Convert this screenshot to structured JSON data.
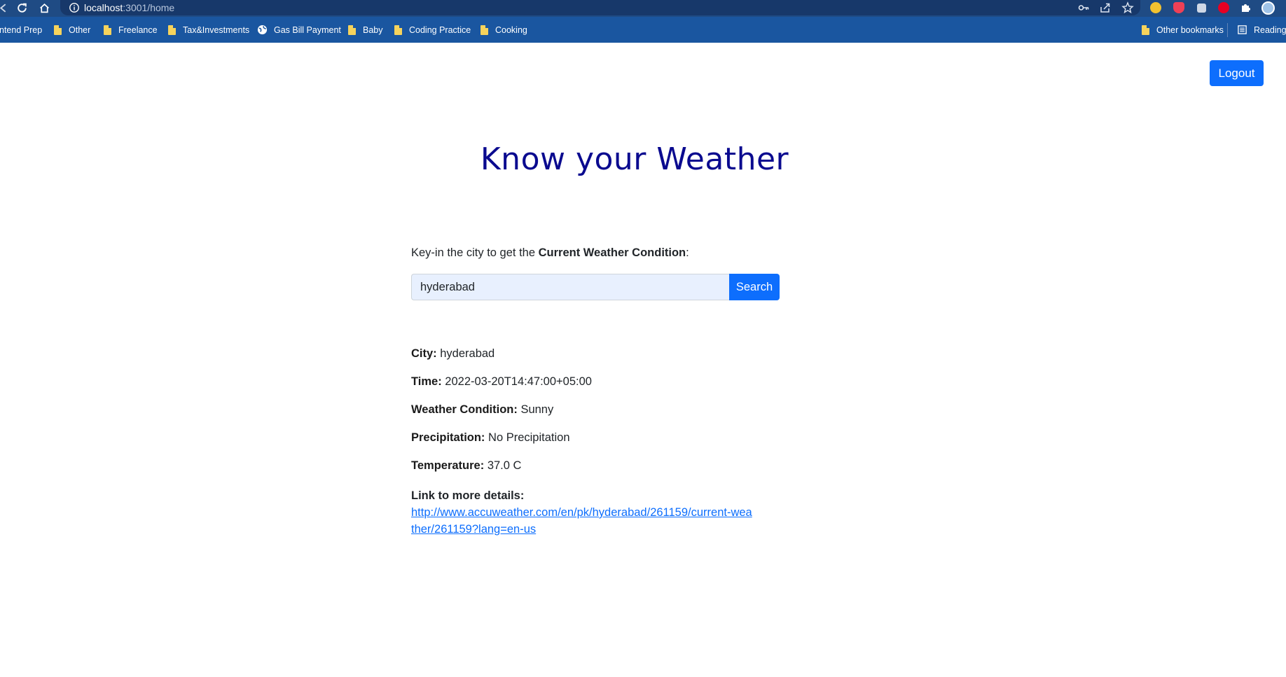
{
  "browser": {
    "address": {
      "host": "localhost",
      "path": ":3001/home"
    },
    "bookmarks": [
      {
        "label": "ntend Prep",
        "icon": "none"
      },
      {
        "label": "Other",
        "icon": "folder-icon"
      },
      {
        "label": "Freelance",
        "icon": "folder-icon"
      },
      {
        "label": "Tax&Investments",
        "icon": "folder-icon"
      },
      {
        "label": "Gas Bill Payment",
        "icon": "globe-icon"
      },
      {
        "label": "Baby",
        "icon": "folder-icon"
      },
      {
        "label": "Coding Practice",
        "icon": "folder-icon"
      },
      {
        "label": "Cooking",
        "icon": "folder-icon"
      }
    ],
    "other_bookmarks": "Other bookmarks",
    "reading_list": "Reading",
    "colors": {
      "toolbar": "#1f4b84",
      "bookmarks_bar": "#1a56a0",
      "folder": "#f6d35c"
    }
  },
  "header": {
    "logout_label": "Logout"
  },
  "main": {
    "title": "Know your Weather",
    "prompt_prefix": "Key-in the city to get the ",
    "prompt_bold": "Current Weather Condition",
    "prompt_suffix": ":",
    "search": {
      "value": "hyderabad",
      "button_label": "Search"
    }
  },
  "results": {
    "city_label": "City:",
    "city_value": " hyderabad",
    "time_label": "Time:",
    "time_value": " 2022-03-20T14:47:00+05:00",
    "condition_label": "Weather Condition:",
    "condition_value": " Sunny",
    "precipitation_label": "Precipitation:",
    "precipitation_value": " No Precipitation",
    "temperature_label": "Temperature:",
    "temperature_value": " 37.0 C",
    "link_label": "Link to more details:",
    "link_url": "http://www.accuweather.com/en/pk/hyderabad/261159/current-weather/261159?lang=en-us"
  },
  "colors": {
    "primary": "#0d6efd",
    "title": "#0a0a8f",
    "input_bg": "#e8f0fe"
  }
}
